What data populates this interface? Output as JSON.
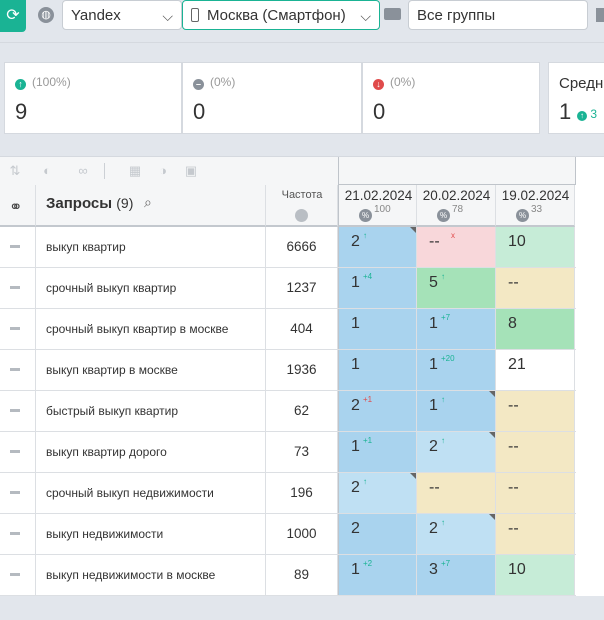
{
  "toolbar": {
    "engine": "Yandex",
    "region": "Москва (Смартфон)",
    "groups": "Все группы"
  },
  "stats": [
    {
      "pct": "(100%)",
      "value": "9",
      "status": "up",
      "color": "#1ab394"
    },
    {
      "pct": "(0%)",
      "value": "0",
      "status": "neutral",
      "color": "#8a919a"
    },
    {
      "pct": "(0%)",
      "value": "0",
      "status": "down",
      "color": "#e04b4b"
    },
    {
      "title": "Средн",
      "value": "1",
      "extra": "3"
    }
  ],
  "table": {
    "header_title": "Запросы",
    "header_count": "(9)",
    "freq_header": "Частота",
    "dates": [
      {
        "date": "21.02.2024",
        "count": "100"
      },
      {
        "date": "20.02.2024",
        "count": "78"
      },
      {
        "date": "19.02.2024",
        "count": "33"
      }
    ],
    "rows": [
      {
        "query": "выкуп квартир",
        "freq": "6666",
        "pos": [
          {
            "v": "2",
            "d": "↑",
            "bg": "#a9d3ee",
            "dc": "#1ab394",
            "corner": true
          },
          {
            "v": "--",
            "d": "x",
            "bg": "#f8d7da",
            "dc": "#e04b4b"
          },
          {
            "v": "10",
            "d": "",
            "bg": "#c6ecd7"
          }
        ]
      },
      {
        "query": "срочный выкуп квартир",
        "freq": "1237",
        "pos": [
          {
            "v": "1",
            "d": "+4",
            "bg": "#a9d3ee",
            "dc": "#1ab394"
          },
          {
            "v": "5",
            "d": "↑",
            "bg": "#a5e2b8",
            "dc": "#1ab394"
          },
          {
            "v": "--",
            "d": "",
            "bg": "#f3e8c4"
          }
        ]
      },
      {
        "query": "срочный выкуп квартир в москве",
        "freq": "404",
        "pos": [
          {
            "v": "1",
            "d": "",
            "bg": "#a9d3ee"
          },
          {
            "v": "1",
            "d": "+7",
            "bg": "#a9d3ee",
            "dc": "#1ab394"
          },
          {
            "v": "8",
            "d": "",
            "bg": "#a5e2b8"
          }
        ]
      },
      {
        "query": "выкуп квартир в москве",
        "freq": "1936",
        "pos": [
          {
            "v": "1",
            "d": "",
            "bg": "#a9d3ee"
          },
          {
            "v": "1",
            "d": "+20",
            "bg": "#a9d3ee",
            "dc": "#1ab394"
          },
          {
            "v": "21",
            "d": "",
            "bg": "#ffffff"
          }
        ]
      },
      {
        "query": "быстрый выкуп квартир",
        "freq": "62",
        "pos": [
          {
            "v": "2",
            "d": "+1",
            "bg": "#a9d3ee",
            "dc": "#e04b4b"
          },
          {
            "v": "1",
            "d": "↑",
            "bg": "#a9d3ee",
            "dc": "#1ab394",
            "corner": true
          },
          {
            "v": "--",
            "d": "",
            "bg": "#f3e8c4"
          }
        ]
      },
      {
        "query": "выкуп квартир дорого",
        "freq": "73",
        "pos": [
          {
            "v": "1",
            "d": "+1",
            "bg": "#a9d3ee",
            "dc": "#1ab394"
          },
          {
            "v": "2",
            "d": "↑",
            "bg": "#bfe0f3",
            "dc": "#1ab394",
            "corner": true
          },
          {
            "v": "--",
            "d": "",
            "bg": "#f3e8c4"
          }
        ]
      },
      {
        "query": "срочный выкуп недвижимости",
        "freq": "196",
        "pos": [
          {
            "v": "2",
            "d": "↑",
            "bg": "#bfe0f3",
            "dc": "#1ab394",
            "corner": true
          },
          {
            "v": "--",
            "d": "",
            "bg": "#f3e8c4"
          },
          {
            "v": "--",
            "d": "",
            "bg": "#f3e8c4"
          }
        ]
      },
      {
        "query": "выкуп недвижимости",
        "freq": "1000",
        "pos": [
          {
            "v": "2",
            "d": "",
            "bg": "#a9d3ee"
          },
          {
            "v": "2",
            "d": "↑",
            "bg": "#bfe0f3",
            "dc": "#1ab394",
            "corner": true
          },
          {
            "v": "--",
            "d": "",
            "bg": "#f3e8c4"
          }
        ]
      },
      {
        "query": "выкуп недвижимости в москве",
        "freq": "89",
        "pos": [
          {
            "v": "1",
            "d": "+2",
            "bg": "#a9d3ee",
            "dc": "#1ab394"
          },
          {
            "v": "3",
            "d": "+7",
            "bg": "#a9d3ee",
            "dc": "#1ab394"
          },
          {
            "v": "10",
            "d": "",
            "bg": "#c6ecd7"
          }
        ]
      }
    ]
  }
}
